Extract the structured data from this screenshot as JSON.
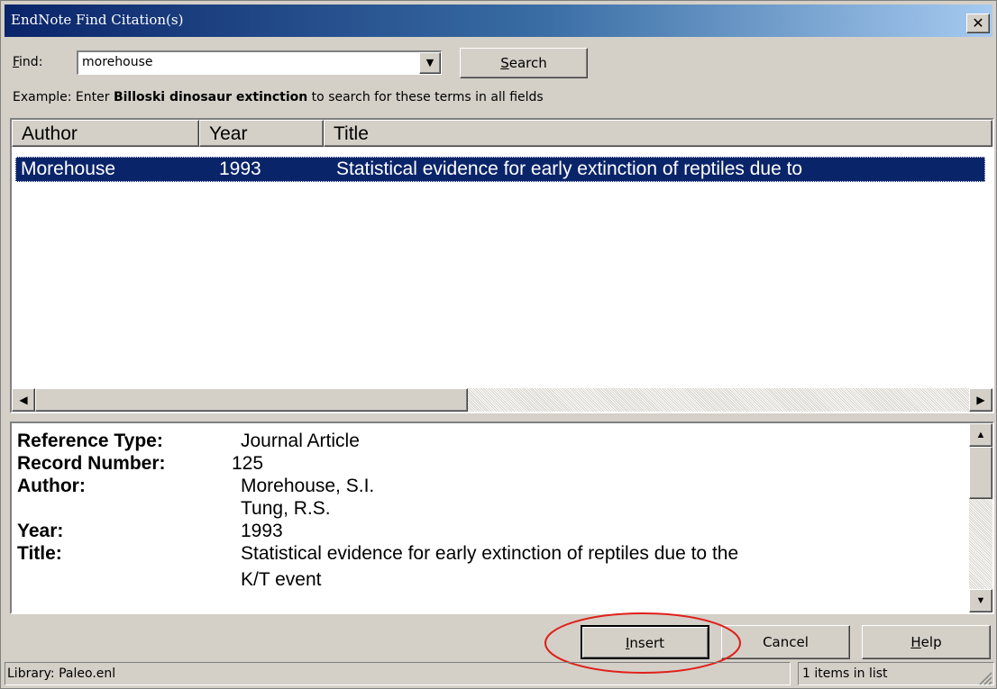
{
  "window": {
    "title": "EndNote Find Citation(s)",
    "close_glyph": "✕"
  },
  "find": {
    "label_key": "F",
    "label_rest": "ind:",
    "value": "morehouse",
    "dropdown_glyph": "▼",
    "search_key": "S",
    "search_rest": "earch"
  },
  "example": {
    "prefix": "Example: Enter ",
    "bold": "Billoski dinosaur extinction",
    "suffix": " to search for these terms in all fields"
  },
  "results": {
    "columns": [
      "Author",
      "Year",
      "Title"
    ],
    "rows": [
      {
        "author": "Morehouse",
        "year": "1993",
        "title": "Statistical evidence for early extinction of reptiles due to"
      }
    ],
    "scroll_left_glyph": "◀",
    "scroll_right_glyph": "▶"
  },
  "detail": {
    "reference_type_label": "Reference Type:",
    "reference_type": "Journal Article",
    "record_number_label": "Record Number:",
    "record_number": "125",
    "author_label": "Author:",
    "authors": [
      "Morehouse, S.I.",
      "Tung, R.S."
    ],
    "year_label": "Year:",
    "year": "1993",
    "title_label": "Title:",
    "title_line1": "Statistical evidence for early extinction of reptiles due to the",
    "title_line2": "K/T event",
    "scroll_up_glyph": "▲",
    "scroll_down_glyph": "▼"
  },
  "buttons": {
    "insert_key": "I",
    "insert_rest": "nsert",
    "cancel": "Cancel",
    "help_key": "H",
    "help_rest": "elp"
  },
  "annotation": {
    "color": "#e0201a"
  },
  "status": {
    "library": "Library: Paleo.enl",
    "count": "1 items in list"
  }
}
